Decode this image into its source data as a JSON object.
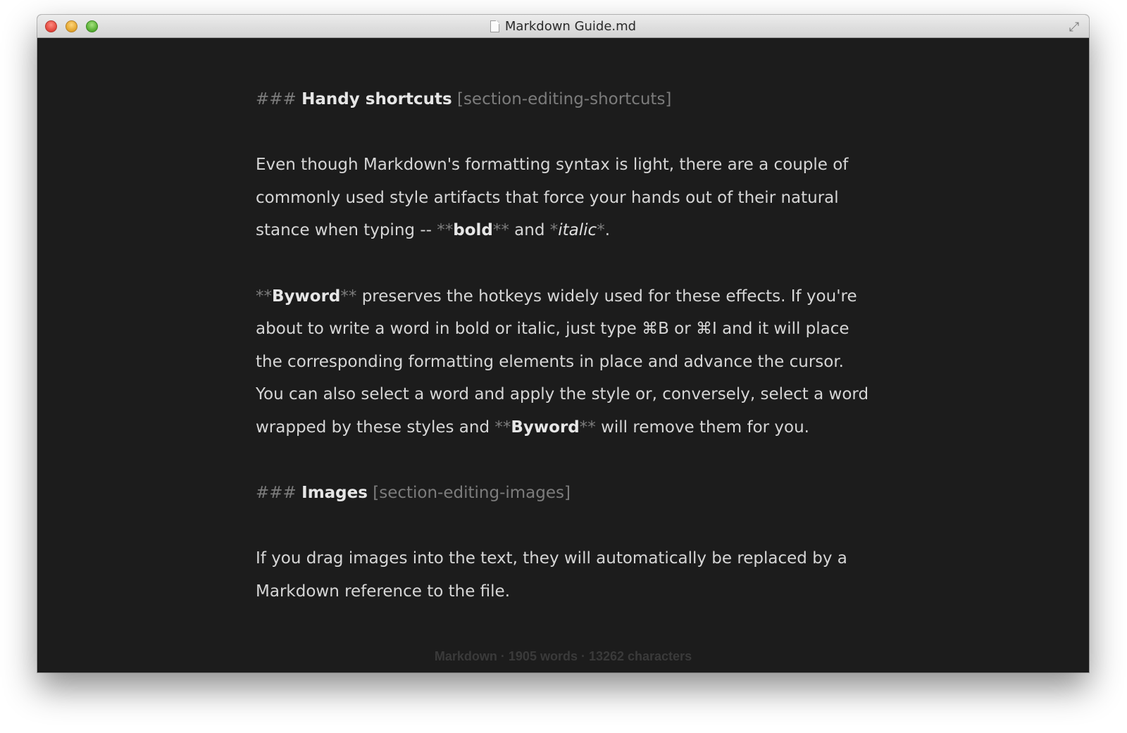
{
  "window": {
    "title": "Markdown Guide.md",
    "controls": {
      "close_icon": "close-icon",
      "minimize_icon": "minimize-icon",
      "zoom_icon": "zoom-icon",
      "fullscreen_icon": "fullscreen-icon"
    },
    "colors": {
      "background": "#1c1c1c",
      "text": "#d6d6d6",
      "markup": "#7c7c7c",
      "titlebar": "#e0e0e0"
    }
  },
  "document": {
    "h1": {
      "hashes": "###",
      "title": "Handy shortcuts",
      "ref": "[section-editing-shortcuts]"
    },
    "p1": {
      "t1": "Even though Markdown's formatting syntax is light, there are a couple of commonly used style artifacts that force your hands out of their natural stance when typing -- ",
      "bold_open": "**",
      "bold": "bold",
      "bold_close": "**",
      "t2": " and ",
      "ital_open": "*",
      "italic": "italic",
      "ital_close": "*",
      "t3": "."
    },
    "p2": {
      "b_open": "**",
      "bold1": "Byword",
      "b_close": "**",
      "t1": " preserves the hotkeys widely used for these effects. If you're about to write a word in bold or italic, just type ⌘B or ⌘I and it will place the corresponding formatting elements in place and advance the cursor. You can also select a word and apply the style or, conversely, select a word wrapped by these styles and ",
      "b2_open": "**",
      "bold2": "Byword",
      "b2_close": "**",
      "t2": " will remove them for you."
    },
    "h2": {
      "hashes": "###",
      "title": "Images",
      "ref": "[section-editing-images]"
    },
    "p3": {
      "text": "If you drag images into the text, they will automatically be replaced by a Markdown reference to the file."
    }
  },
  "status": {
    "text": "Markdown · 1905 words · 13262 characters"
  }
}
